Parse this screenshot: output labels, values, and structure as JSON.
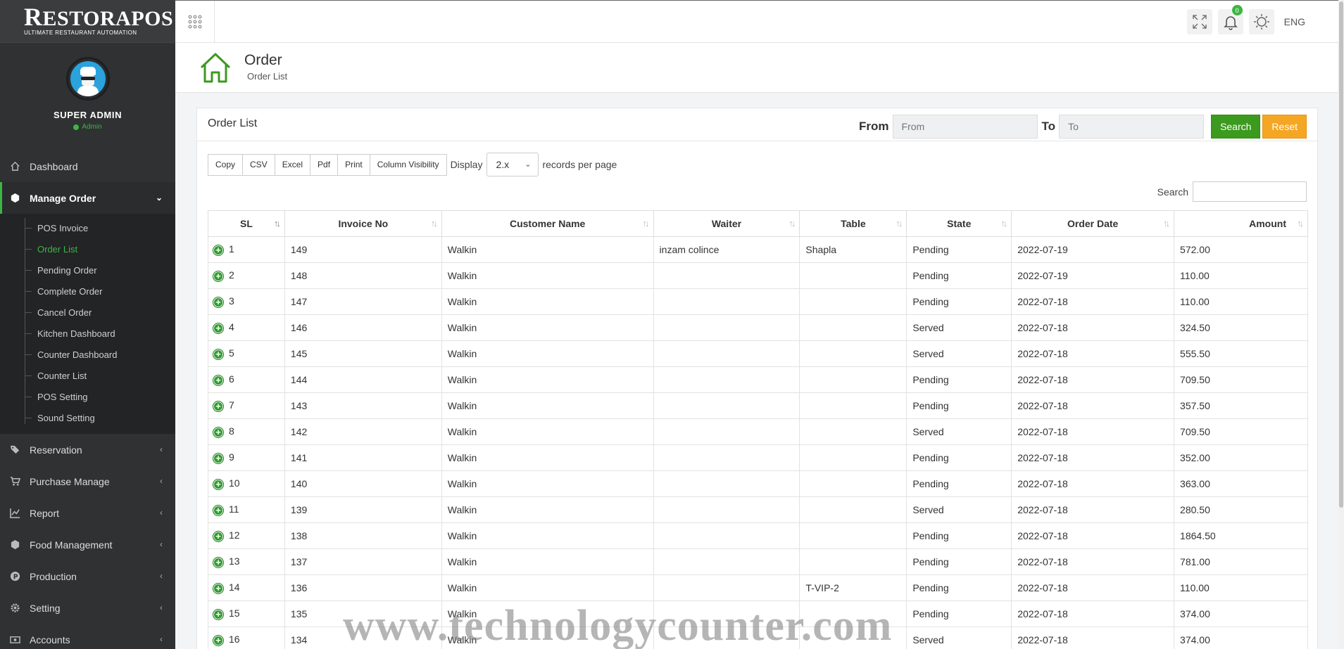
{
  "brand": {
    "name": "ESTORAPOS",
    "initial": "R",
    "tagline": "ULTIMATE RESTAURANT AUTOMATION"
  },
  "profile": {
    "name": "SUPER ADMIN",
    "role": "Admin"
  },
  "sidebar": {
    "dashboard": "Dashboard",
    "manage_order": "Manage Order",
    "sub_items": [
      "POS Invoice",
      "Order List",
      "Pending Order",
      "Complete Order",
      "Cancel Order",
      "Kitchen Dashboard",
      "Counter Dashboard",
      "Counter List",
      "POS Setting",
      "Sound Setting"
    ],
    "reservation": "Reservation",
    "purchase_manage": "Purchase Manage",
    "report": "Report",
    "food_management": "Food Management",
    "production": "Production",
    "setting": "Setting",
    "accounts": "Accounts"
  },
  "topbar": {
    "notification_count": "0",
    "language": "ENG"
  },
  "page": {
    "title": "Order",
    "subtitle": "Order List"
  },
  "card": {
    "title": "Order List",
    "from_label": "From",
    "from_placeholder": "From",
    "to_label": "To",
    "to_placeholder": "To",
    "search_button": "Search",
    "reset_button": "Reset"
  },
  "tools": {
    "buttons": [
      "Copy",
      "CSV",
      "Excel",
      "Pdf",
      "Print",
      "Column Visibility"
    ],
    "display_label": "Display",
    "page_length": "2.x",
    "records_label": "records per page",
    "search_label": "Search"
  },
  "table": {
    "headers": [
      "SL",
      "Invoice No",
      "Customer Name",
      "Waiter",
      "Table",
      "State",
      "Order Date",
      "Amount"
    ],
    "rows": [
      [
        "1",
        "149",
        "Walkin",
        "inzam colince",
        "Shapla",
        "Pending",
        "2022-07-19",
        "572.00"
      ],
      [
        "2",
        "148",
        "Walkin",
        "",
        "",
        "Pending",
        "2022-07-19",
        "110.00"
      ],
      [
        "3",
        "147",
        "Walkin",
        "",
        "",
        "Pending",
        "2022-07-18",
        "110.00"
      ],
      [
        "4",
        "146",
        "Walkin",
        "",
        "",
        "Served",
        "2022-07-18",
        "324.50"
      ],
      [
        "5",
        "145",
        "Walkin",
        "",
        "",
        "Served",
        "2022-07-18",
        "555.50"
      ],
      [
        "6",
        "144",
        "Walkin",
        "",
        "",
        "Pending",
        "2022-07-18",
        "709.50"
      ],
      [
        "7",
        "143",
        "Walkin",
        "",
        "",
        "Pending",
        "2022-07-18",
        "357.50"
      ],
      [
        "8",
        "142",
        "Walkin",
        "",
        "",
        "Served",
        "2022-07-18",
        "709.50"
      ],
      [
        "9",
        "141",
        "Walkin",
        "",
        "",
        "Pending",
        "2022-07-18",
        "352.00"
      ],
      [
        "10",
        "140",
        "Walkin",
        "",
        "",
        "Pending",
        "2022-07-18",
        "363.00"
      ],
      [
        "11",
        "139",
        "Walkin",
        "",
        "",
        "Served",
        "2022-07-18",
        "280.50"
      ],
      [
        "12",
        "138",
        "Walkin",
        "",
        "",
        "Pending",
        "2022-07-18",
        "1864.50"
      ],
      [
        "13",
        "137",
        "Walkin",
        "",
        "",
        "Pending",
        "2022-07-18",
        "781.00"
      ],
      [
        "14",
        "136",
        "Walkin",
        "",
        "T-VIP-2",
        "Pending",
        "2022-07-18",
        "110.00"
      ],
      [
        "15",
        "135",
        "Walkin",
        "",
        "",
        "Pending",
        "2022-07-18",
        "374.00"
      ],
      [
        "16",
        "134",
        "Walkin",
        "",
        "",
        "Served",
        "2022-07-18",
        "374.00"
      ]
    ]
  },
  "watermark": "www.technologycounter.com",
  "colors": {
    "accent_green": "#3db542",
    "search_green": "#3c9a1f",
    "reset_orange": "#f5a623",
    "sidebar_bg": "#2f3133"
  }
}
